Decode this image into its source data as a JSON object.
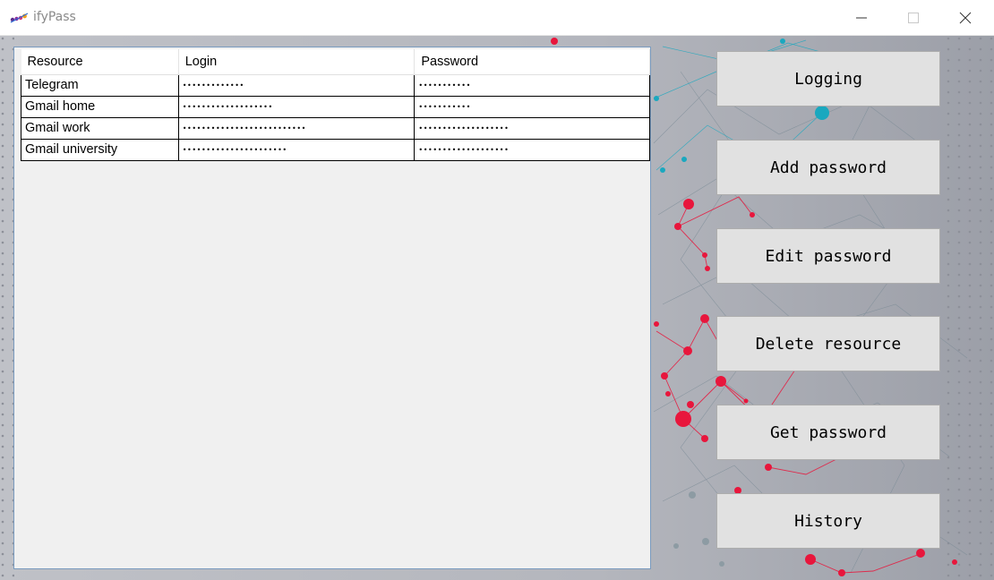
{
  "window": {
    "title": "ifyPass",
    "icon": "app-logo-icon",
    "controls": [
      "minimize-icon",
      "maximize-icon",
      "close-icon"
    ]
  },
  "table": {
    "columns": [
      "Resource",
      "Login",
      "Password"
    ],
    "rows": [
      {
        "resource": "Telegram",
        "login": "•••••••••••••",
        "password": "•••••••••••"
      },
      {
        "resource": "Gmail home",
        "login": "•••••••••••••••••••",
        "password": "•••••••••••"
      },
      {
        "resource": "Gmail work",
        "login": "••••••••••••••••••••••••••",
        "password": "•••••••••••••••••••"
      },
      {
        "resource": "Gmail university",
        "login": "••••••••••••••••••••••",
        "password": "•••••••••••••••••••"
      }
    ]
  },
  "actions": {
    "logging": "Logging",
    "add_password": "Add password",
    "edit_password": "Edit password",
    "delete_resource": "Delete resource",
    "get_password": "Get password",
    "history": "History"
  },
  "colors": {
    "background": "#a9acb4",
    "network_red": "#e8163c",
    "network_cyan": "#1aa8bf",
    "button_face": "#e1e1e1"
  }
}
